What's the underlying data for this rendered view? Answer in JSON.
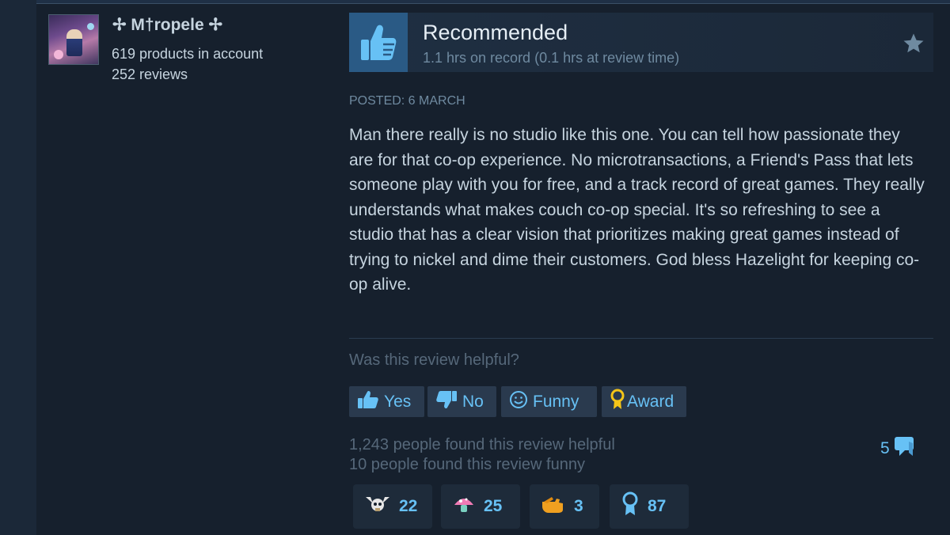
{
  "author": {
    "name": "✢ M†ropele ✢",
    "products": "619 products in account",
    "reviews": "252 reviews"
  },
  "review": {
    "verdict": "Recommended",
    "hours": "1.1 hrs on record (0.1 hrs at review time)",
    "posted": "POSTED: 6 MARCH",
    "text": "Man there really is no studio like this one. You can tell how passionate they are for that co-op experience. No microtransactions, a Friend's Pass that lets someone play with you for free, and a track record of great games. They really understands what makes couch co-op special. It's so refreshing to see a studio that has a clear vision that prioritizes making great games instead of trying to nickel and dime their customers. God bless Hazelight for keeping co-op alive."
  },
  "helpful": {
    "question": "Was this review helpful?",
    "buttons": {
      "yes": "Yes",
      "no": "No",
      "funny": "Funny",
      "award": "Award"
    },
    "found_helpful": "1,243 people found this review helpful",
    "found_funny": "10 people found this review funny",
    "comment_count": "5"
  },
  "awards": [
    {
      "icon": "horned-skull-icon",
      "count": "22"
    },
    {
      "icon": "mushroom-icon",
      "count": "25"
    },
    {
      "icon": "pointing-hand-icon",
      "count": "3"
    },
    {
      "icon": "ribbon-medal-icon",
      "count": "87"
    }
  ],
  "colors": {
    "background": "#1b2838",
    "accent": "#67c1f5",
    "thumb_box": "#2a5a85",
    "muted_text": "#56687a"
  }
}
